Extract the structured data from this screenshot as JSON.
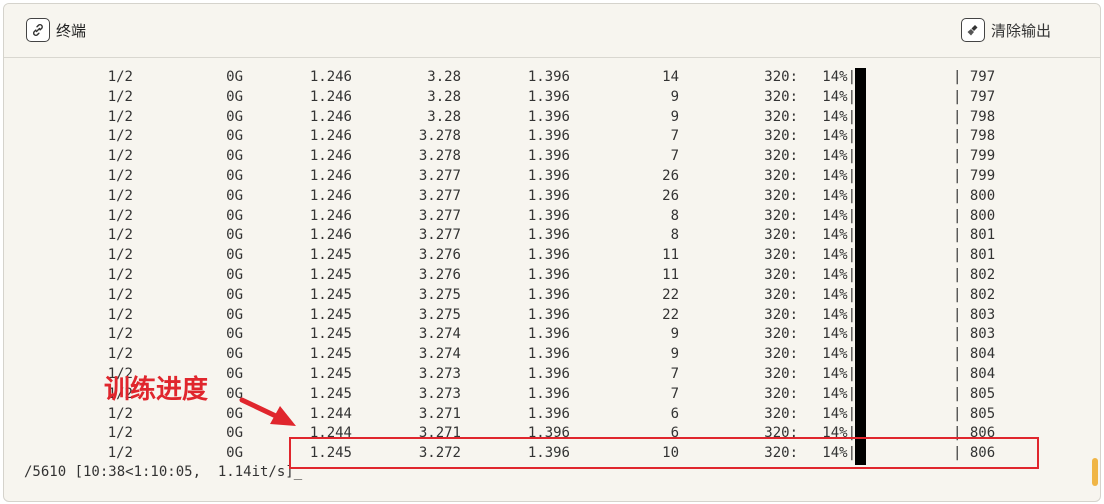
{
  "header": {
    "terminal_label": "终端",
    "clear_label": "清除输出",
    "terminal_icon": "link-icon",
    "clear_icon": "broom-icon"
  },
  "rows": [
    [
      "1/2",
      "0G",
      "1.246",
      "3.28",
      "1.396",
      "14",
      "320:",
      "14%|",
      "| 797"
    ],
    [
      "1/2",
      "0G",
      "1.246",
      "3.28",
      "1.396",
      "9",
      "320:",
      "14%|",
      "| 797"
    ],
    [
      "1/2",
      "0G",
      "1.246",
      "3.28",
      "1.396",
      "9",
      "320:",
      "14%|",
      "| 798"
    ],
    [
      "1/2",
      "0G",
      "1.246",
      "3.278",
      "1.396",
      "7",
      "320:",
      "14%|",
      "| 798"
    ],
    [
      "1/2",
      "0G",
      "1.246",
      "3.278",
      "1.396",
      "7",
      "320:",
      "14%|",
      "| 799"
    ],
    [
      "1/2",
      "0G",
      "1.246",
      "3.277",
      "1.396",
      "26",
      "320:",
      "14%|",
      "| 799"
    ],
    [
      "1/2",
      "0G",
      "1.246",
      "3.277",
      "1.396",
      "26",
      "320:",
      "14%|",
      "| 800"
    ],
    [
      "1/2",
      "0G",
      "1.246",
      "3.277",
      "1.396",
      "8",
      "320:",
      "14%|",
      "| 800"
    ],
    [
      "1/2",
      "0G",
      "1.246",
      "3.277",
      "1.396",
      "8",
      "320:",
      "14%|",
      "| 801"
    ],
    [
      "1/2",
      "0G",
      "1.245",
      "3.276",
      "1.396",
      "11",
      "320:",
      "14%|",
      "| 801"
    ],
    [
      "1/2",
      "0G",
      "1.245",
      "3.276",
      "1.396",
      "11",
      "320:",
      "14%|",
      "| 802"
    ],
    [
      "1/2",
      "0G",
      "1.245",
      "3.275",
      "1.396",
      "22",
      "320:",
      "14%|",
      "| 802"
    ],
    [
      "1/2",
      "0G",
      "1.245",
      "3.275",
      "1.396",
      "22",
      "320:",
      "14%|",
      "| 803"
    ],
    [
      "1/2",
      "0G",
      "1.245",
      "3.274",
      "1.396",
      "9",
      "320:",
      "14%|",
      "| 803"
    ],
    [
      "1/2",
      "0G",
      "1.245",
      "3.274",
      "1.396",
      "9",
      "320:",
      "14%|",
      "| 804"
    ],
    [
      "1/2",
      "0G",
      "1.245",
      "3.273",
      "1.396",
      "7",
      "320:",
      "14%|",
      "| 804"
    ],
    [
      "1/2",
      "0G",
      "1.245",
      "3.273",
      "1.396",
      "7",
      "320:",
      "14%|",
      "| 805"
    ],
    [
      "1/2",
      "0G",
      "1.244",
      "3.271",
      "1.396",
      "6",
      "320:",
      "14%|",
      "| 805"
    ],
    [
      "1/2",
      "0G",
      "1.244",
      "3.271",
      "1.396",
      "6",
      "320:",
      "14%|",
      "| 806"
    ],
    [
      "1/2",
      "0G",
      "1.245",
      "3.272",
      "1.396",
      "10",
      "320:",
      "14%|",
      "| 806"
    ]
  ],
  "status_line": "/5610 [10:38<1:10:05,  1.14it/s]_",
  "annotation": {
    "text": "训练进度",
    "color": "#e0262d"
  }
}
